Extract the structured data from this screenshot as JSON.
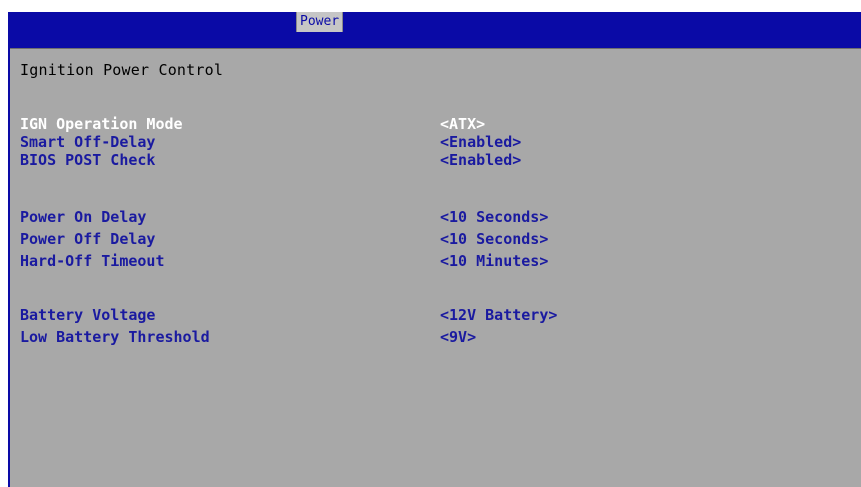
{
  "header": {
    "active_tab": "Power"
  },
  "page": {
    "title": "Ignition Power Control"
  },
  "settings": [
    {
      "label": "IGN Operation Mode",
      "value": "<ATX>",
      "selected": true
    },
    {
      "label": "Smart Off-Delay",
      "value": "<Enabled>"
    },
    {
      "label": "BIOS POST Check",
      "value": "<Enabled>"
    },
    {
      "label": "Power On Delay",
      "value": "<10 Seconds>"
    },
    {
      "label": "Power Off Delay",
      "value": "<10 Seconds>"
    },
    {
      "label": "Hard-Off Timeout",
      "value": "<10 Minutes>"
    },
    {
      "label": "Battery Voltage",
      "value": "<12V Battery>"
    },
    {
      "label": "Low Battery Threshold",
      "value": "<9V>"
    }
  ],
  "colors": {
    "header_blue": "#0a0aa6",
    "panel_gray": "#a8a8a8",
    "item_blue": "#1a1aa0",
    "selected_white": "#ffffff"
  }
}
